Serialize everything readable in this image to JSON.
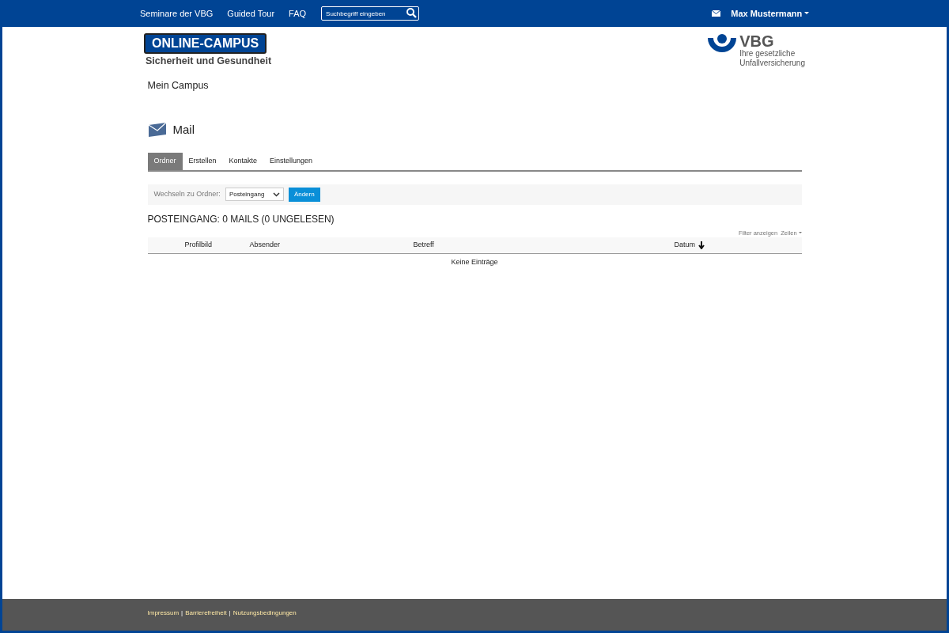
{
  "topnav": {
    "links": [
      "Seminare der VBG",
      "Guided Tour",
      "FAQ"
    ],
    "search": {
      "placeholder": "Suchbegriff eingeben"
    },
    "user": "Max Mustermann"
  },
  "logo": {
    "title": "ONLINE-CAMPUS",
    "subtitle": "Sicherheit und Gesundheit"
  },
  "brand": {
    "name": "VBG",
    "tagline": [
      "Ihre gesetzliche",
      "Unfallversicherung"
    ]
  },
  "breadcrumb": "Mein Campus",
  "heading": "Mail",
  "tabs": [
    {
      "label": "Ordner",
      "selected": true
    },
    {
      "label": "Erstellen",
      "selected": false
    },
    {
      "label": "Kontakte",
      "selected": false
    },
    {
      "label": "Einstellungen",
      "selected": false
    }
  ],
  "folder_bar": {
    "label": "Wechseln zu Ordner:",
    "value": "Posteingang",
    "button": "Ändern"
  },
  "list_title": "POSTEINGANG: 0 MAILS (0 UNGELESEN)",
  "table_tools": {
    "filter": "Filter anzeigen",
    "rows": "Zeilen"
  },
  "table": {
    "columns": [
      {
        "label": "Profilbild",
        "sorted": false
      },
      {
        "label": "Absender",
        "sorted": false
      },
      {
        "label": "Betreff",
        "sorted": false
      },
      {
        "label": "Datum",
        "sorted": true
      }
    ],
    "empty": "Keine Einträge"
  },
  "footer": {
    "links": [
      "Impressum",
      "Barrierefreiheit",
      "Nutzungsbedingungen"
    ],
    "separator": "|"
  }
}
